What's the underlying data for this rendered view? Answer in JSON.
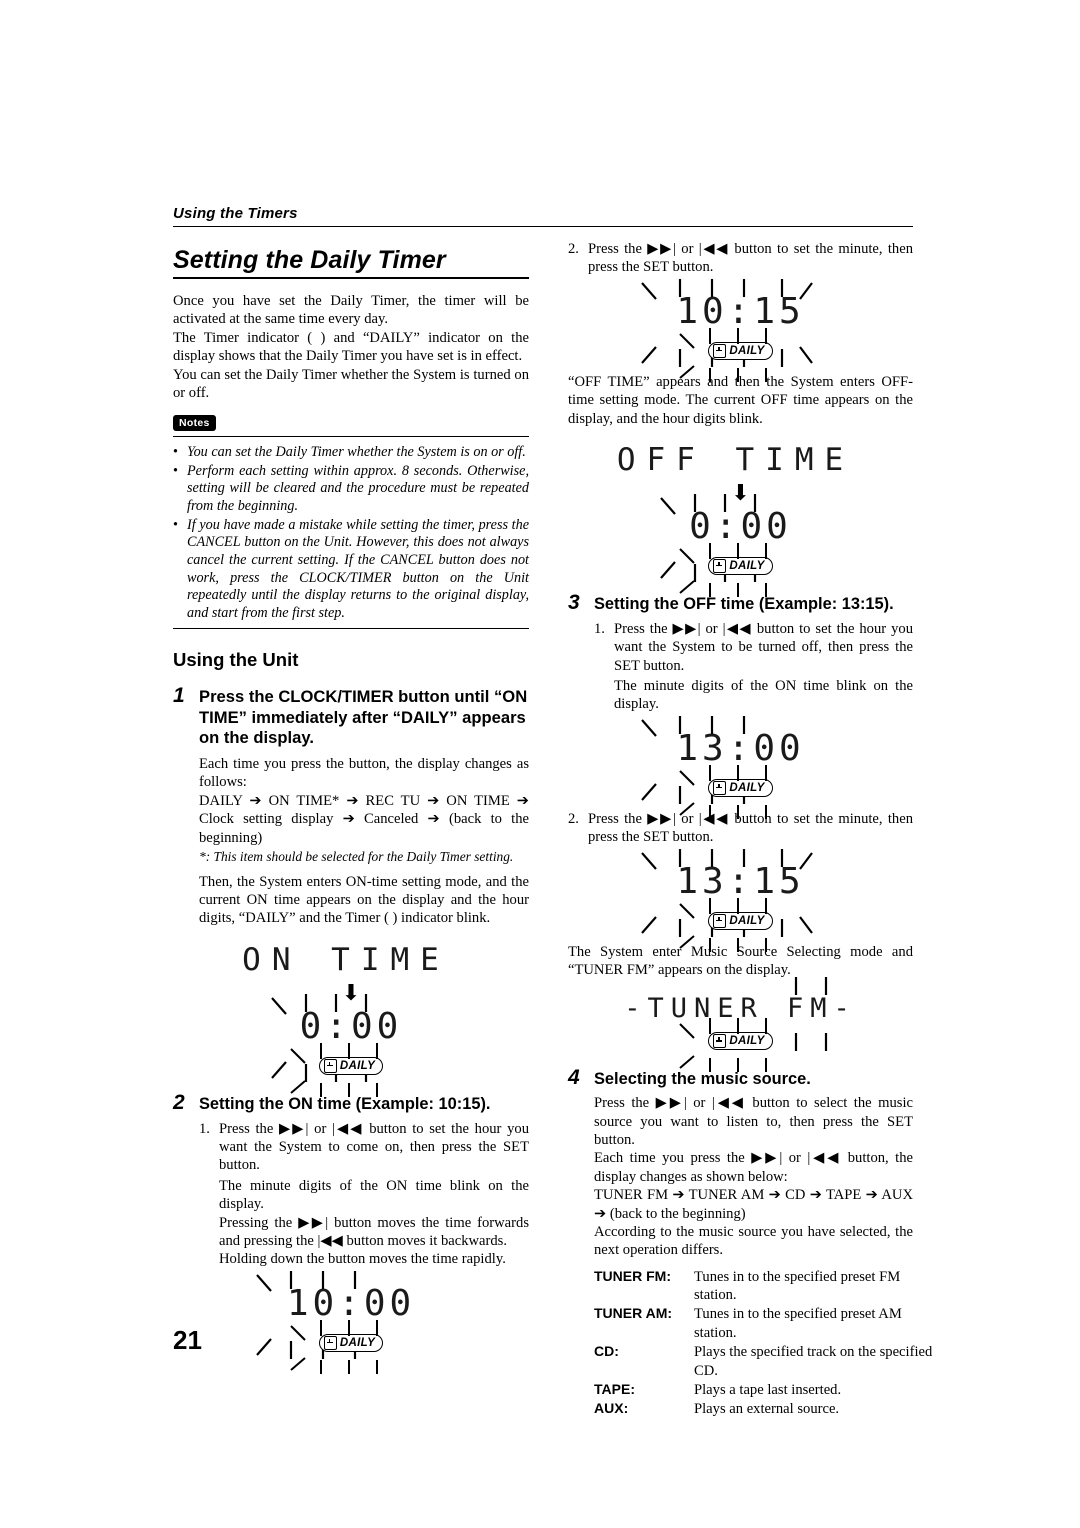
{
  "page": {
    "running_head": "Using the Timers",
    "folio": "21"
  },
  "left": {
    "title": "Setting the Daily Timer",
    "intro": [
      "Once you have set the Daily Timer, the timer will be activated at the same time every day.",
      "The Timer indicator (   ) and “DAILY” indicator on the display shows that the Daily Timer you have set is in effect.",
      "You can set the Daily Timer whether the System is turned on or off."
    ],
    "notes_badge": "Notes",
    "notes": [
      "You can set the Daily Timer whether the System is on or off.",
      "Perform each setting within approx. 8 seconds. Otherwise, setting will be cleared and the procedure must be repeated from the beginning.",
      "If you have made a mistake while setting the timer, press the CANCEL button on the Unit. However, this does not always cancel the current setting. If the CANCEL button does not work, press the CLOCK/TIMER button on the Unit repeatedly until the display returns to the original display, and start from the first step."
    ],
    "using_the_unit": "Using the Unit",
    "step1": {
      "num": "1",
      "title": "Press the CLOCK/TIMER button until “ON TIME” immediately after “DAILY” appears on the display.",
      "para1": "Each time you press the button, the display changes as follows:",
      "chain": "DAILY ➔ ON TIME* ➔ REC TU ➔ ON TIME ➔ Clock setting display ➔ Canceled ➔ (back to the beginning)",
      "footnote": "*: This item should be selected for the Daily Timer setting.",
      "para2": "Then, the System enters ON-time setting mode, and the current ON time appears on the display and the hour digits, “DAILY” and the Timer (   ) indicator blink.",
      "lcd_word": "ON TIME",
      "lcd_digits": "0:00",
      "daily_label": "DAILY"
    },
    "step2": {
      "num": "2",
      "title": "Setting the ON time (Example: 10:15).",
      "items": [
        {
          "marker": "1.",
          "text": "Press the ▶▶| or |◀◀ button to set the hour you want the System to come on, then press the SET button."
        }
      ],
      "para_a": "The minute digits of the ON time blink on the display.",
      "para_b": "Pressing the ▶▶| button moves the time forwards and pressing the |◀◀ button moves it backwards.",
      "para_c": "Holding down the button moves the time rapidly.",
      "lcd_digits": "10:00",
      "daily_label": "DAILY"
    }
  },
  "right": {
    "top_item": {
      "marker": "2.",
      "text": "Press the ▶▶| or |◀◀ button to set the minute, then press the SET button."
    },
    "lcd_1015": "10:15",
    "daily_label": "DAILY",
    "para_offtime": "“OFF TIME” appears and then the System enters OFF-time setting mode. The current OFF time appears on the display, and the hour digits blink.",
    "lcd_offtime_word": "OFF TIME",
    "lcd_offtime_digits": "0:00",
    "step3": {
      "num": "3",
      "title": "Setting the OFF time (Example: 13:15).",
      "item1_marker": "1.",
      "item1_text": "Press the ▶▶| or |◀◀ button to set the hour you want the System to be turned off, then press the SET button.",
      "item1_para": "The minute digits of the ON time blink on the display.",
      "lcd_1300": "13:00",
      "item2_marker": "2.",
      "item2_text": "Press the ▶▶| or |◀◀ button to set the minute, then press the SET button.",
      "lcd_1315": "13:15",
      "para_tuner": "The System enter Music Source Selecting mode and “TUNER FM” appears on the display.",
      "lcd_tuner": "-TUNER FM-"
    },
    "step4": {
      "num": "4",
      "title": "Selecting the music source.",
      "para1": "Press the ▶▶| or |◀◀ button to select the music source you want to listen to, then press the SET button.",
      "para2": "Each time you press the ▶▶| or |◀◀ button, the display changes as shown below:",
      "chain": "TUNER FM ➔ TUNER AM ➔ CD ➔ TAPE ➔ AUX ➔ (back to the beginning)",
      "para3": "According to the music source you have selected, the next operation differs.",
      "table": [
        {
          "key": "TUNER FM",
          "sep": ":",
          "desc": "Tunes in to the specified preset FM station."
        },
        {
          "key": "TUNER AM",
          "sep": ":",
          "desc": "Tunes in to the specified preset AM station."
        },
        {
          "key": "CD",
          "sep": ":",
          "desc": "Plays the specified track on the specified CD."
        },
        {
          "key": "TAPE",
          "sep": ":",
          "desc": "Plays a tape last inserted."
        },
        {
          "key": "AUX",
          "sep": ":",
          "desc": "Plays an external source."
        }
      ]
    }
  }
}
